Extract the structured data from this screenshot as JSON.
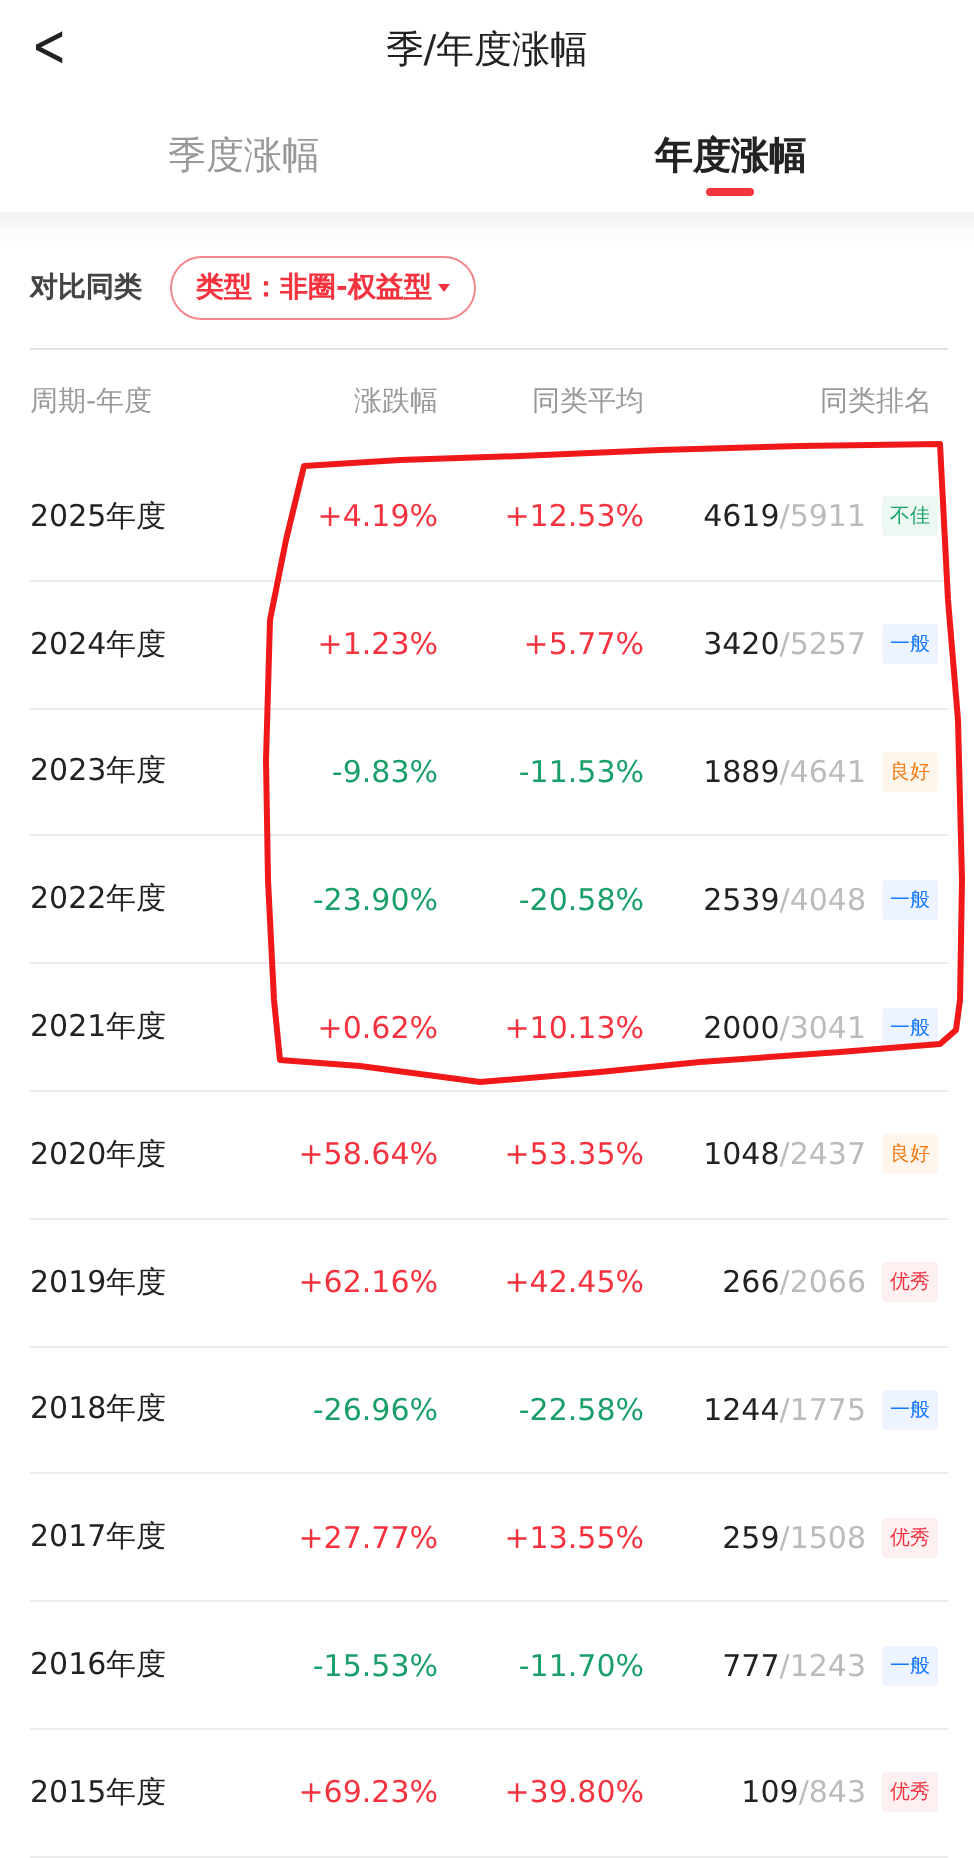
{
  "header": {
    "back": "<",
    "title": "季/年度涨幅"
  },
  "tabs": [
    {
      "label": "季度涨幅",
      "selected": false
    },
    {
      "label": "年度涨幅",
      "selected": true
    }
  ],
  "filter": {
    "label": "对比同类",
    "dropdown": "类型：非圈-权益型"
  },
  "table": {
    "columns": [
      "周期-年度",
      "涨跌幅",
      "同类平均",
      "同类排名"
    ],
    "rows": [
      {
        "period": "2025年度",
        "change": {
          "text": "+4.19%",
          "kind": "up"
        },
        "average": {
          "text": "+12.53%",
          "kind": "up"
        },
        "rank": "4619",
        "total": "/5911",
        "rating": {
          "text": "不佳",
          "color": "#1aa36b"
        }
      },
      {
        "period": "2024年度",
        "change": {
          "text": "+1.23%",
          "kind": "up"
        },
        "average": {
          "text": "+5.77%",
          "kind": "up"
        },
        "rank": "3420",
        "total": "/5257",
        "rating": {
          "text": "一般",
          "color": "#1677ff"
        }
      },
      {
        "period": "2023年度",
        "change": {
          "text": "-9.83%",
          "kind": "down"
        },
        "average": {
          "text": "-11.53%",
          "kind": "down"
        },
        "rank": "1889",
        "total": "/4641",
        "rating": {
          "text": "良好",
          "color": "#f07a12"
        }
      },
      {
        "period": "2022年度",
        "change": {
          "text": "-23.90%",
          "kind": "down"
        },
        "average": {
          "text": "-20.58%",
          "kind": "down"
        },
        "rank": "2539",
        "total": "/4048",
        "rating": {
          "text": "一般",
          "color": "#1677ff"
        }
      },
      {
        "period": "2021年度",
        "change": {
          "text": "+0.62%",
          "kind": "up"
        },
        "average": {
          "text": "+10.13%",
          "kind": "up"
        },
        "rank": "2000",
        "total": "/3041",
        "rating": {
          "text": "一般",
          "color": "#1677ff"
        }
      },
      {
        "period": "2020年度",
        "change": {
          "text": "+58.64%",
          "kind": "up"
        },
        "average": {
          "text": "+53.35%",
          "kind": "up"
        },
        "rank": "1048",
        "total": "/2437",
        "rating": {
          "text": "良好",
          "color": "#f07a12"
        }
      },
      {
        "period": "2019年度",
        "change": {
          "text": "+62.16%",
          "kind": "up"
        },
        "average": {
          "text": "+42.45%",
          "kind": "up"
        },
        "rank": "266",
        "total": "/2066",
        "rating": {
          "text": "优秀",
          "color": "#f5333f"
        }
      },
      {
        "period": "2018年度",
        "change": {
          "text": "-26.96%",
          "kind": "down"
        },
        "average": {
          "text": "-22.58%",
          "kind": "down"
        },
        "rank": "1244",
        "total": "/1775",
        "rating": {
          "text": "一般",
          "color": "#1677ff"
        }
      },
      {
        "period": "2017年度",
        "change": {
          "text": "+27.77%",
          "kind": "up"
        },
        "average": {
          "text": "+13.55%",
          "kind": "up"
        },
        "rank": "259",
        "total": "/1508",
        "rating": {
          "text": "优秀",
          "color": "#f5333f"
        }
      },
      {
        "period": "2016年度",
        "change": {
          "text": "-15.53%",
          "kind": "down"
        },
        "average": {
          "text": "-11.70%",
          "kind": "down"
        },
        "rank": "777",
        "total": "/1243",
        "rating": {
          "text": "一般",
          "color": "#1677ff"
        }
      },
      {
        "period": "2015年度",
        "change": {
          "text": "+69.23%",
          "kind": "up"
        },
        "average": {
          "text": "+39.80%",
          "kind": "up"
        },
        "rank": "109",
        "total": "/843",
        "rating": {
          "text": "优秀",
          "color": "#f5333f"
        }
      }
    ]
  }
}
